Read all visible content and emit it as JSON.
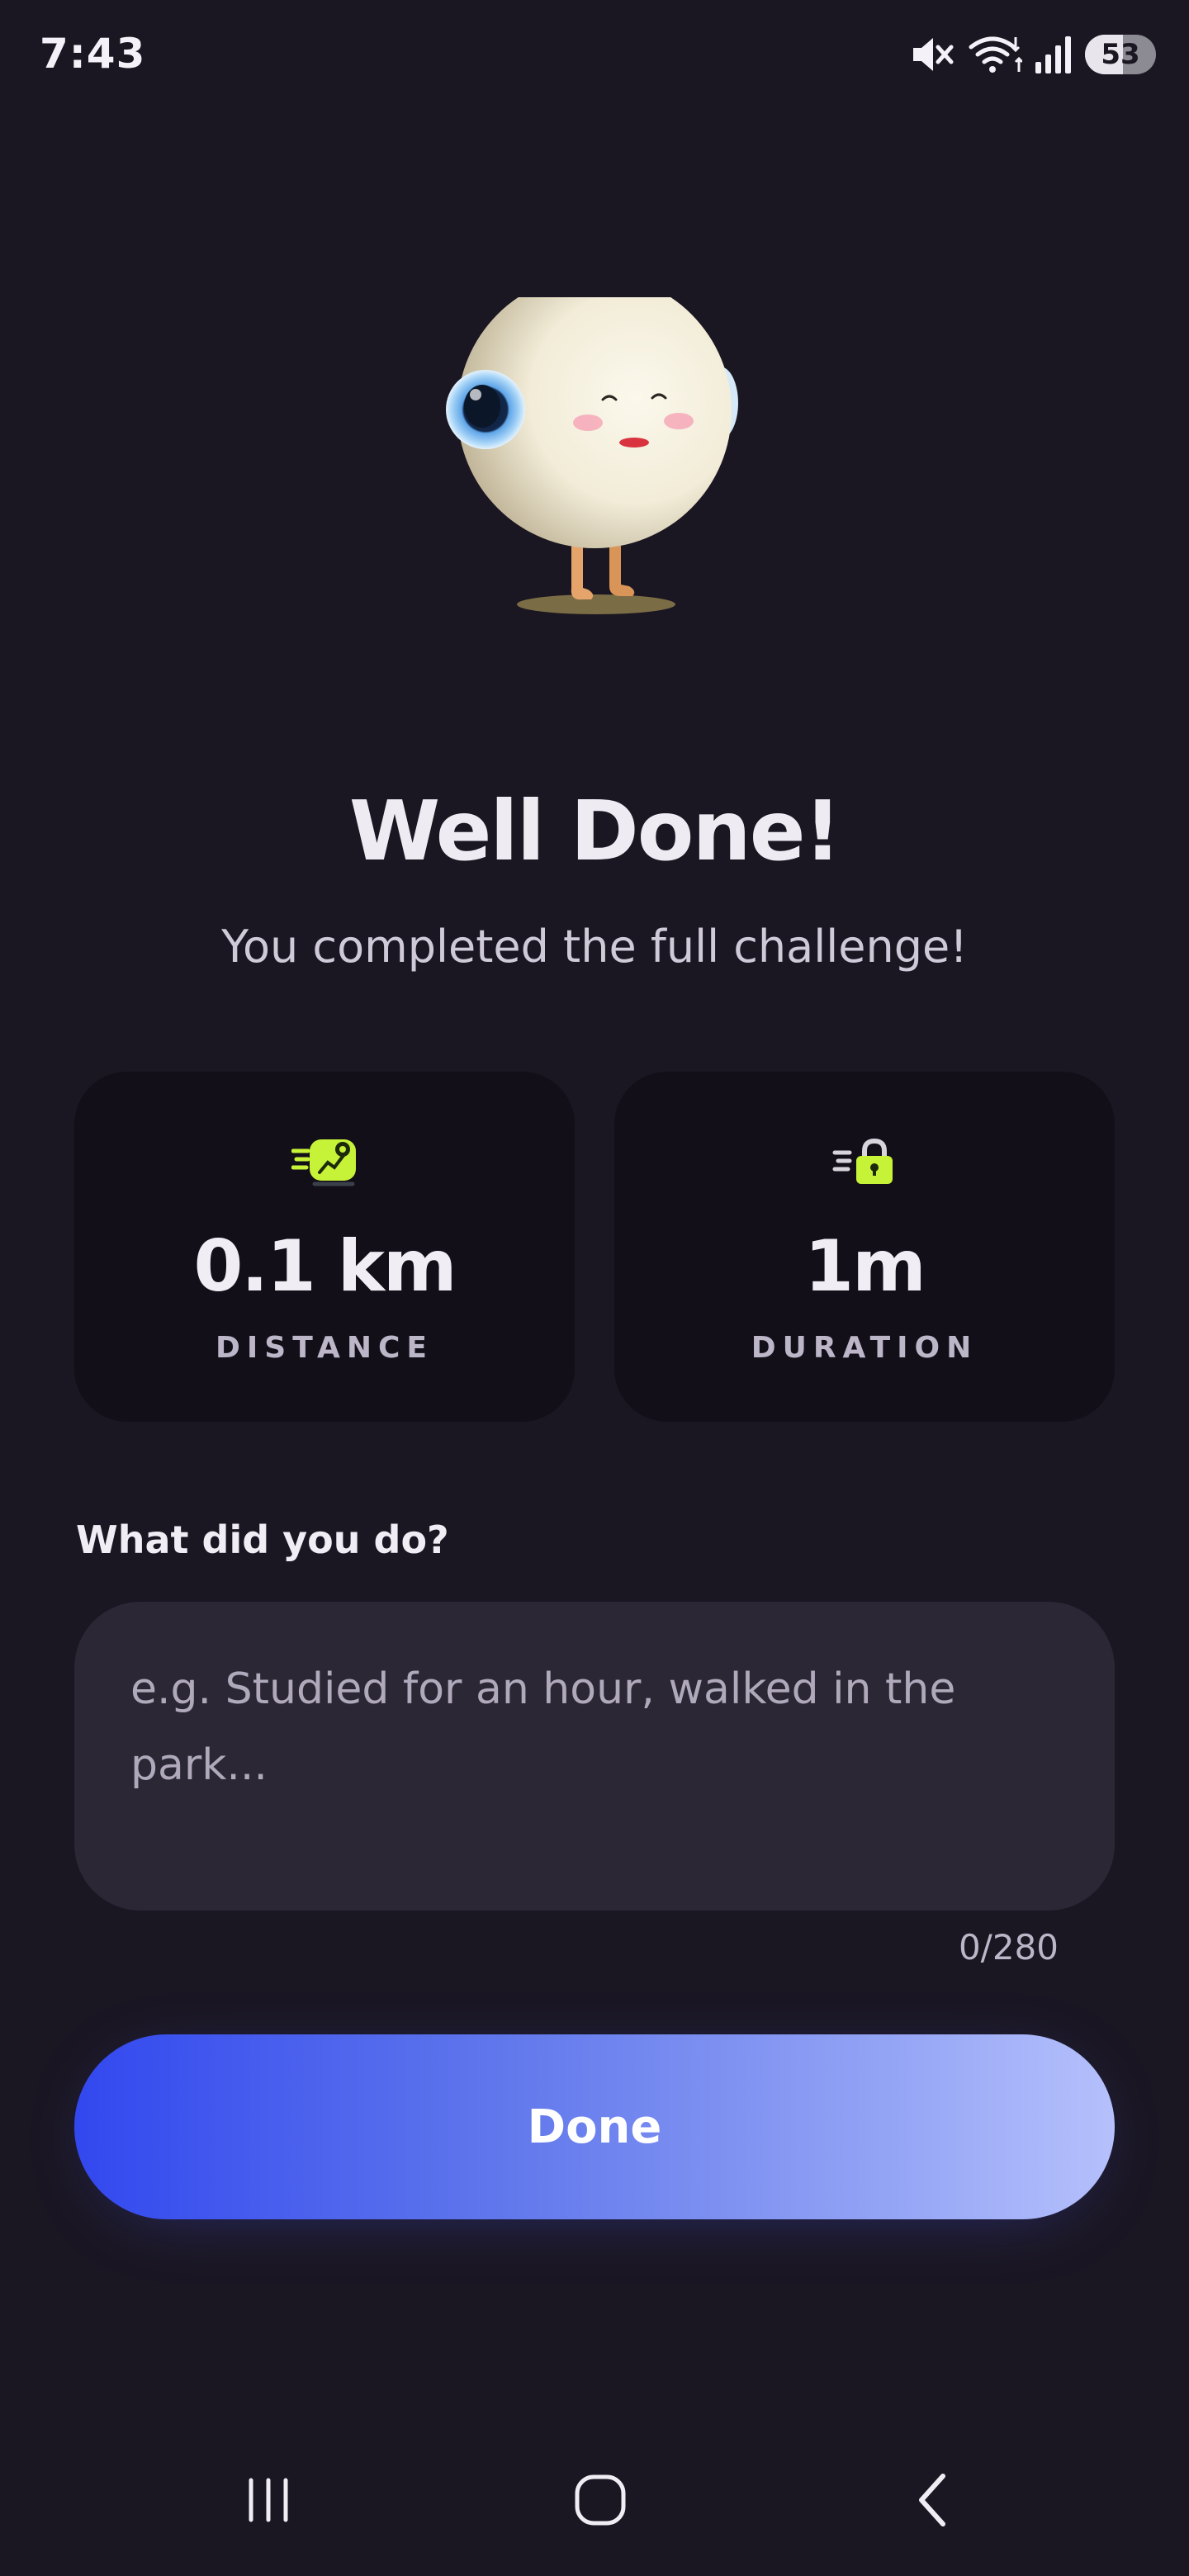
{
  "status_bar": {
    "time": "7:43",
    "battery": "53",
    "battery_level_percent": 53,
    "icons": [
      "mute-icon",
      "wifi-icon",
      "signal-icon",
      "battery-icon"
    ]
  },
  "completion": {
    "title": "Well Done!",
    "subtitle": "You completed the full challenge!"
  },
  "stats": [
    {
      "icon": "distance-icon",
      "value": "0.1 km",
      "label": "DISTANCE"
    },
    {
      "icon": "duration-icon",
      "value": "1m",
      "label": "DURATION"
    }
  ],
  "note": {
    "label": "What did you do?",
    "placeholder": "e.g. Studied for an hour, walked in the park...",
    "value": "",
    "char_count": "0/280"
  },
  "done_button": {
    "label": "Done"
  },
  "nav_bar": {
    "buttons": [
      "recent-apps-icon",
      "home-icon",
      "back-icon"
    ]
  },
  "colors": {
    "background": "#1a1622",
    "card": "#120f18",
    "input": "#2c2735",
    "accent_icon": "#c6f238",
    "button_gradient_start": "#3248ef",
    "button_gradient_end": "#b5c0fc"
  }
}
